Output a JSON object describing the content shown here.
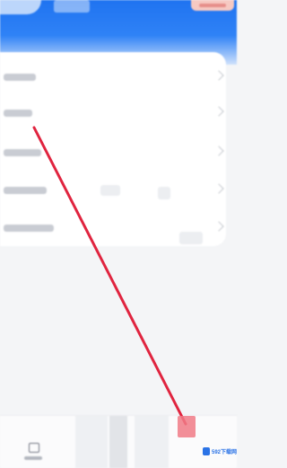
{
  "header": {
    "title_icon": "app-title-glyph",
    "badge_icon": "notification-badge"
  },
  "settings_list": {
    "rows": [
      {
        "icon": "chevron-right-icon"
      },
      {
        "icon": "chevron-right-icon"
      },
      {
        "icon": "chevron-right-icon"
      },
      {
        "icon": "chevron-right-icon"
      },
      {
        "icon": "chevron-right-icon"
      }
    ]
  },
  "tabbar": {
    "active_tab_icon": "tv-icon"
  },
  "annotation": {
    "color": "#e0243f",
    "target_color": "#f07a86",
    "shape": "red-arrow-line-to-highlighted-box"
  },
  "watermark": {
    "text": "592下载网",
    "color": "#2b73e6"
  }
}
